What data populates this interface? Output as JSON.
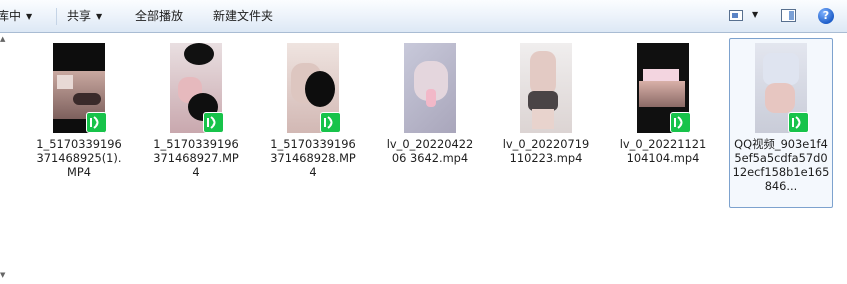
{
  "toolbar": {
    "library_label": "库中",
    "share_label": "共享",
    "play_all_label": "全部播放",
    "new_folder_label": "新建文件夹",
    "help_glyph": "?"
  },
  "files": [
    {
      "name": "1_5170339196371468925(1).MP4",
      "selected": false
    },
    {
      "name": "1_5170339196371468927.MP4",
      "selected": false
    },
    {
      "name": "1_5170339196371468928.MP4",
      "selected": false
    },
    {
      "name": "lv_0_2022042206 3642.mp4",
      "selected": false
    },
    {
      "name": "lv_0_20220719110223.mp4",
      "selected": false
    },
    {
      "name": "lv_0_20221121104104.mp4",
      "selected": false
    },
    {
      "name": "QQ视频_903e1f45ef5a5cdfa57d012ecf158b1e165846...",
      "selected": true
    }
  ],
  "colors": {
    "badge": "#17c34a",
    "selection_border": "#7da2ce",
    "toolbar_top": "#fbfdff",
    "toolbar_bottom": "#dde8f5"
  },
  "icons": {
    "toolbar": [
      "view-options-icon",
      "preview-pane-icon",
      "help-icon"
    ],
    "file_badge": "video-player-icon"
  }
}
